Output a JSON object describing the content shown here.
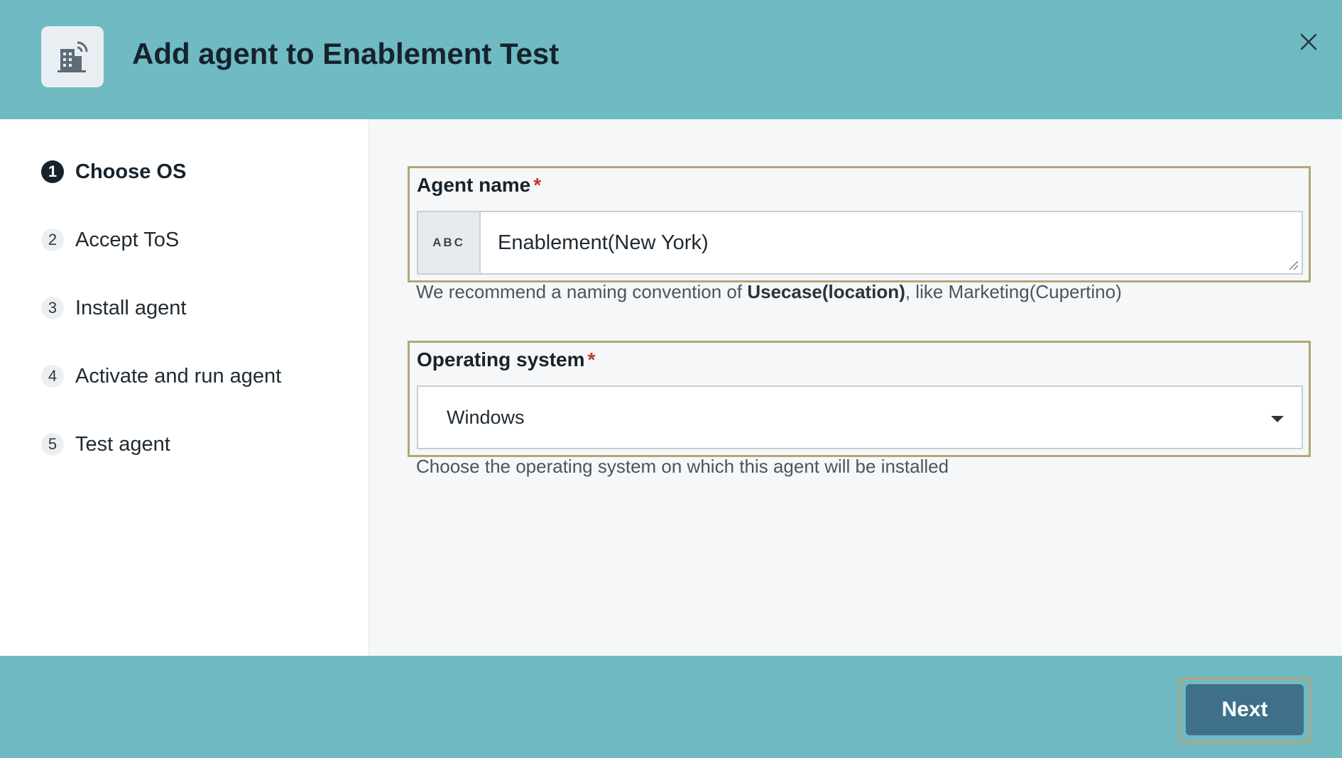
{
  "header": {
    "title": "Add agent to Enablement Test",
    "icon": "building-antenna-icon",
    "close_icon": "close-icon"
  },
  "steps": [
    {
      "number": "1",
      "label": "Choose OS",
      "active": true
    },
    {
      "number": "2",
      "label": "Accept ToS",
      "active": false
    },
    {
      "number": "3",
      "label": "Install agent",
      "active": false
    },
    {
      "number": "4",
      "label": "Activate and run agent",
      "active": false
    },
    {
      "number": "5",
      "label": "Test agent",
      "active": false
    }
  ],
  "agent_name": {
    "label": "Agent name",
    "required_mark": "*",
    "type_tag": "ABC",
    "value": "Enablement(New York)",
    "hint_prefix": "We recommend a naming convention of ",
    "hint_bold": "Usecase(location)",
    "hint_suffix": ", like Marketing(Cupertino)"
  },
  "operating_system": {
    "label": "Operating system",
    "required_mark": "*",
    "selected": "Windows",
    "hint": "Choose the operating system on which this agent will be installed"
  },
  "footer": {
    "next_label": "Next"
  },
  "colors": {
    "header_bg": "#6fbac3",
    "footer_bg": "#6fbac3",
    "primary_button": "#3f7089",
    "highlight_outline": "#b3a679",
    "required": "#c0392b"
  }
}
